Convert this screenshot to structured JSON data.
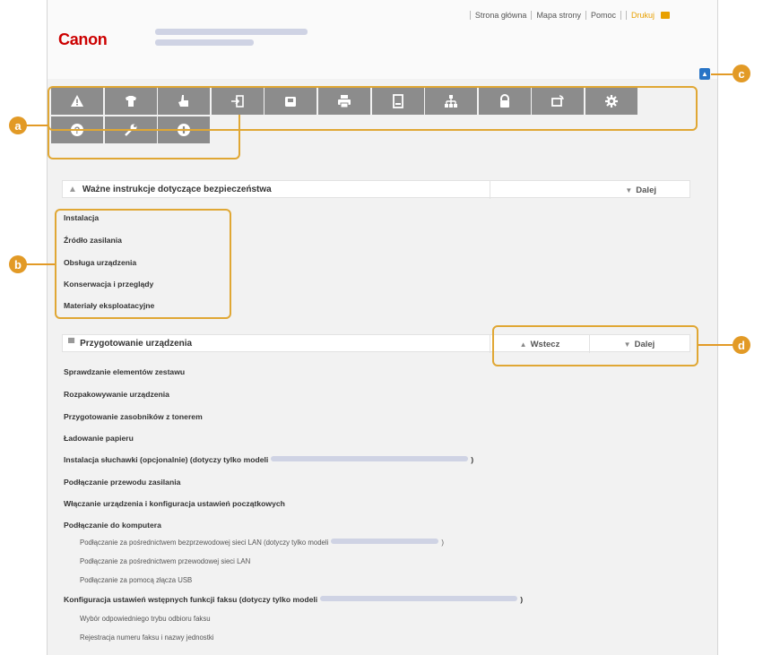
{
  "header": {
    "brand": "Canon",
    "topnav": [
      "Strona główna",
      "Mapa strony",
      "Pomoc",
      "Drukuj"
    ]
  },
  "iconbar": {
    "row1": [
      "warning-icon",
      "shirt-icon",
      "hand-pointer-icon",
      "login-icon",
      "fax-icon",
      "printer-icon",
      "copier-icon",
      "network-icon",
      "lock-icon",
      "device-link-icon",
      "gear-icon"
    ],
    "row2": [
      "help-icon",
      "wrench-icon",
      "plus-circle-icon"
    ]
  },
  "callouts": {
    "a": "a",
    "b": "b",
    "c": "c",
    "d": "d"
  },
  "scroll_top_glyph": "▲",
  "section1": {
    "title": "Ważne instrukcje dotyczące bezpieczeństwa",
    "next": "Dalej",
    "links": [
      "Instalacja",
      "Źródło zasilania",
      "Obsługa urządzenia",
      "Konserwacja i przeglądy",
      "Materiały eksploatacyjne"
    ]
  },
  "section2": {
    "title": "Przygotowanie urządzenia",
    "prev": "Wstecz",
    "next": "Dalej",
    "links": {
      "l0": "Sprawdzanie elementów zestawu",
      "l1": "Rozpakowywanie urządzenia",
      "l2": "Przygotowanie zasobników z tonerem",
      "l3": "Ładowanie papieru",
      "l4a": "Instalacja słuchawki (opcjonalnie) (dotyczy tylko modeli",
      "l4b": ")",
      "l5": "Podłączanie przewodu zasilania",
      "l6": "Włączanie urządzenia i konfiguracja ustawień początkowych",
      "l7": "Podłączanie do komputera",
      "s1a": "Podłączanie za pośrednictwem bezprzewodowej sieci LAN (dotyczy tylko modeli",
      "s1b": ")",
      "s2": "Podłączanie za pośrednictwem przewodowej sieci LAN",
      "s3": "Podłączanie za pomocą złącza USB",
      "l8a": "Konfiguracja ustawień wstępnych funkcji faksu (dotyczy tylko modeli",
      "l8b": ")",
      "s4": "Wybór odpowiedniego trybu odbioru faksu",
      "s5": "Rejestracja numeru faksu i nazwy jednostki"
    }
  },
  "colors": {
    "accent": "#e29a26",
    "iconbar": "#8c8c8c",
    "brand": "#cc0000"
  }
}
